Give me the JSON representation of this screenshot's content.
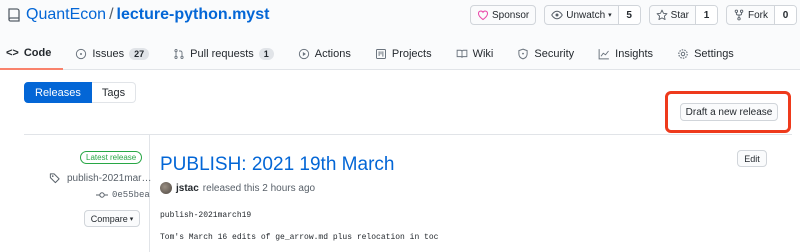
{
  "repo": {
    "owner": "QuantEcon",
    "separator": "/",
    "name": "lecture-python.myst"
  },
  "actions": {
    "sponsor_label": "Sponsor",
    "watch_label": "Unwatch",
    "watch_count": "5",
    "star_label": "Star",
    "star_count": "1",
    "fork_label": "Fork",
    "fork_count": "0"
  },
  "nav": {
    "code": "Code",
    "issues": "Issues",
    "issues_count": "27",
    "pulls": "Pull requests",
    "pulls_count": "1",
    "actions": "Actions",
    "projects": "Projects",
    "wiki": "Wiki",
    "security": "Security",
    "insights": "Insights",
    "settings": "Settings"
  },
  "toolbar": {
    "releases_tab": "Releases",
    "tags_tab": "Tags",
    "draft_label": "Draft a new release"
  },
  "release": {
    "latest_label": "Latest release",
    "tag": "publish-2021mar…",
    "commit": "0e55bea",
    "compare_label": "Compare",
    "title": "PUBLISH: 2021 19th March",
    "author": "jstac",
    "meta": "released this 2 hours ago",
    "edit_label": "Edit",
    "body_line1": "publish-2021march19",
    "body_line2": "Tom's March 16 edits of ge_arrow.md plus relocation in toc"
  },
  "colors": {
    "link": "#0366d6",
    "selected_tab_underline": "#f9826c",
    "latest_green": "#28a745",
    "highlight_red": "#ee3a1c"
  },
  "icons": {
    "repo": "book-icon",
    "sponsor": "heart-icon",
    "watch": "eye-icon",
    "star": "star-icon",
    "fork": "fork-icon",
    "tag": "tag-icon",
    "commit": "git-commit-icon"
  }
}
